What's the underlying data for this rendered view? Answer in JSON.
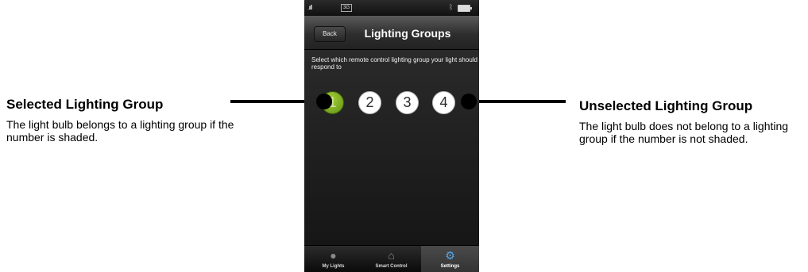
{
  "callouts": {
    "left": {
      "title": "Selected Lighting Group",
      "description": "The light bulb belongs to a lighting group if the number is shaded."
    },
    "right": {
      "title": "Unselected Lighting Group",
      "description": "The light bulb does not belong to a lighting group if the number is not shaded."
    }
  },
  "status_bar": {
    "signal": ".ııll",
    "network": "3G",
    "icons": [
      "signal-icon",
      "bluetooth-icon",
      "battery-icon"
    ]
  },
  "nav_bar": {
    "back_label": "Back",
    "title": "Lighting Groups"
  },
  "content": {
    "instruction": "Select which remote control lighting group your light should respond to",
    "groups": [
      {
        "label": "1",
        "selected": true
      },
      {
        "label": "2",
        "selected": false
      },
      {
        "label": "3",
        "selected": false
      },
      {
        "label": "4",
        "selected": false
      }
    ]
  },
  "tab_bar": {
    "tabs": [
      {
        "label": "My Lights",
        "icon": "light-bulb-icon",
        "active": false
      },
      {
        "label": "Smart Control",
        "icon": "house-gear-icon",
        "active": false
      },
      {
        "label": "Settings",
        "icon": "gear-icon",
        "active": true
      }
    ]
  },
  "colors": {
    "selected_green": "#7fb32a",
    "unselected_white": "#ffffff",
    "active_tab_icon": "#59a6e6"
  }
}
